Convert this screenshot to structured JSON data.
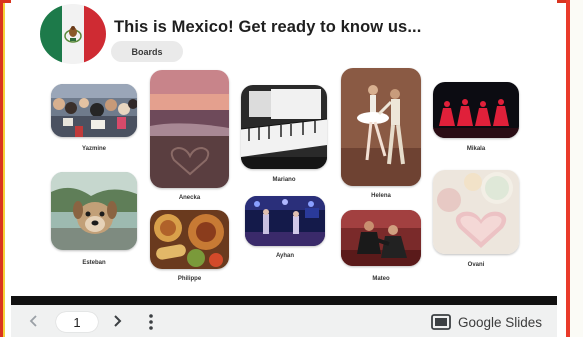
{
  "header": {
    "title": "This is Mexico! Get ready to know us...",
    "boards_label": "Boards"
  },
  "cards": [
    {
      "caption": "Yazmine",
      "image": "crowd-protest-photo"
    },
    {
      "caption": "Esteban",
      "image": "dog-photo"
    },
    {
      "caption": "Anecka",
      "image": "beach-sunset-heart-photo"
    },
    {
      "caption": "Philippe",
      "image": "mexican-food-photo"
    },
    {
      "caption": "Mariano",
      "image": "piano-photo"
    },
    {
      "caption": "Ayhan",
      "image": "concert-stage-photo"
    },
    {
      "caption": "Helena",
      "image": "ballet-dancers-photo"
    },
    {
      "caption": "Mateo",
      "image": "martial-arts-photo"
    },
    {
      "caption": "Mikala",
      "image": "red-dancers-photo"
    },
    {
      "caption": "Ovani",
      "image": "pastel-cakes-photo"
    }
  ],
  "footer": {
    "page_number": "1",
    "brand_label": "Google Slides"
  },
  "colors": {
    "flag_green": "#1d7a4a",
    "flag_white": "#f2f2f2",
    "flag_red": "#cf2b33",
    "frame_red": "#d9341f",
    "google_slides_yellow": "#f4b400"
  },
  "icons": [
    "chevron-left-icon",
    "chevron-right-icon",
    "more-vertical-icon",
    "google-slides-icon",
    "mexico-flag"
  ]
}
